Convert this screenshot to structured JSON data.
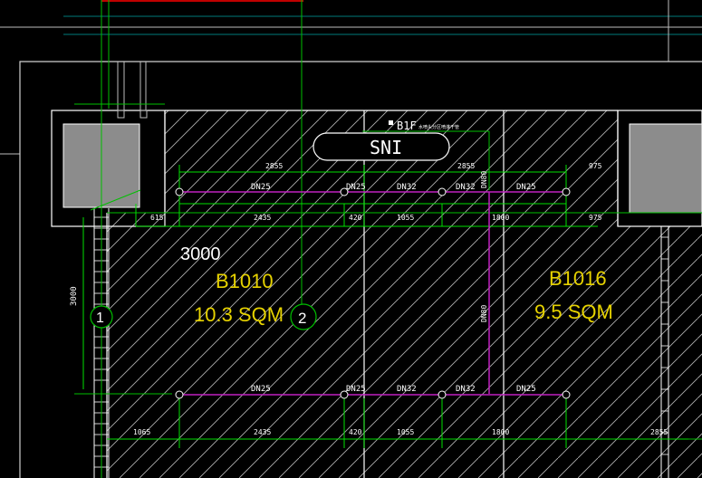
{
  "colors": {
    "background": "#000000",
    "wall": "#ffffff",
    "grid_line": "#00c000",
    "dimension": "#00e000",
    "pipe": "#c020c0",
    "room_label": "#e6d200",
    "equipment_fill": "#8c8c8c",
    "red_line": "#c00000",
    "cyan_line": "#007a7a"
  },
  "header_label": {
    "text": "B1F",
    "note": "水喷头分区喷淋干管"
  },
  "sni_label": "SNI",
  "vertical_dimension": "3000",
  "area_dimension": "3000",
  "grid_bubbles": [
    "1",
    "2"
  ],
  "rooms": [
    {
      "code": "B1010",
      "area": "10.3 SQM"
    },
    {
      "code": "B1016",
      "area": "9.5 SQM"
    }
  ],
  "pipe_labels_top": [
    "DN25",
    "DN25",
    "DN32",
    "DN32",
    "DN25"
  ],
  "pipe_labels_bottom": [
    "DN25",
    "DN25",
    "DN32",
    "DN32",
    "DN25"
  ],
  "riser_labels": [
    "DN80",
    "DN80"
  ],
  "dims_top_upper": [
    "2855",
    "2855",
    "975"
  ],
  "dims_top_lower": [
    "615",
    "2435",
    "420",
    "1055",
    "1800",
    "975"
  ],
  "dims_bottom": [
    "1065",
    "2435",
    "420",
    "1055",
    "1800",
    "2855"
  ]
}
